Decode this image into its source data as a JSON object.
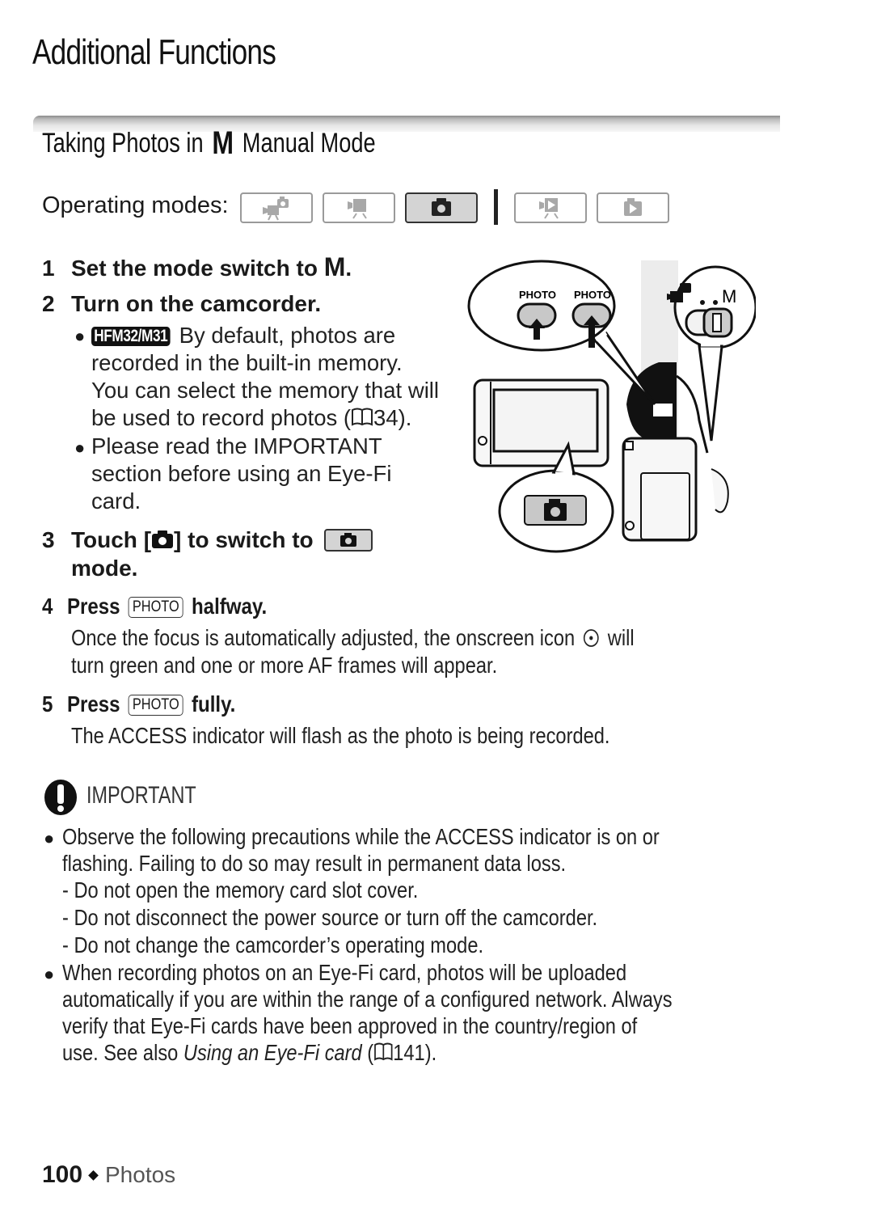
{
  "page": {
    "title": "Additional Functions",
    "section_title_pre": "Taking Photos in",
    "section_title_mode_glyph": "M",
    "section_title_post": "Manual Mode"
  },
  "operating_modes": {
    "label": "Operating modes:",
    "modes": [
      {
        "name": "smart-auto-video",
        "icon": "video-photo-icon",
        "active": false
      },
      {
        "name": "movie-record",
        "icon": "movie-camera-icon",
        "active": false
      },
      {
        "name": "photo-record",
        "icon": "camera-icon",
        "active": true
      },
      {
        "name": "movie-playback",
        "icon": "movie-playback-icon",
        "active": false
      },
      {
        "name": "photo-playback",
        "icon": "photo-playback-icon",
        "active": false
      }
    ]
  },
  "steps": [
    {
      "num": "1",
      "text": "Set the mode switch to",
      "glyph": "M",
      "end": "."
    },
    {
      "num": "2",
      "text": "Turn on the camcorder."
    },
    {
      "num": "3",
      "text_a": "Touch [",
      "text_b": "] to switch to",
      "text_c": "mode."
    },
    {
      "num": "4",
      "text_a": "Press",
      "key": "PHOTO",
      "text_b": "halfway.",
      "desc": [
        "Once the focus is automatically adjusted, the onscreen icon",
        "will",
        "turn green and one or more AF frames will appear."
      ]
    },
    {
      "num": "5",
      "text_a": "Press",
      "key": "PHOTO",
      "text_b": "fully.",
      "desc": [
        "The ACCESS indicator will flash as the photo is being recorded."
      ]
    }
  ],
  "step2_bullets": {
    "badge": "HFM32/M31",
    "b1": [
      "By default, photos are",
      "recorded in the built-in memory.",
      "You can select the memory that will",
      "be used to record photos (",
      "34)."
    ],
    "b2": [
      "Please read the IMPORTANT",
      "section before using an Eye-Fi",
      "card."
    ]
  },
  "illustration": {
    "photo_label_1": "PHOTO",
    "photo_label_2": "PHOTO",
    "switch_label": "M"
  },
  "important": {
    "label": "IMPORTANT",
    "bullet1": [
      "Observe the following precautions while the ACCESS indicator is on or",
      "flashing. Failing to do so may result in permanent data loss."
    ],
    "dashes": [
      "- Do not open the memory card slot cover.",
      "- Do not disconnect the power source or turn off the camcorder.",
      "- Do not change the camcorder’s operating mode."
    ],
    "bullet2": [
      "When recording photos on an Eye-Fi card, photos will be uploaded",
      "automatically if you are within the range of a configured network. Always",
      "verify that Eye-Fi cards have been approved in the country/region of",
      "use. See also ",
      "Using an Eye-Fi card",
      " (",
      "141)."
    ]
  },
  "footer": {
    "page_number": "100",
    "section": "Photos"
  }
}
